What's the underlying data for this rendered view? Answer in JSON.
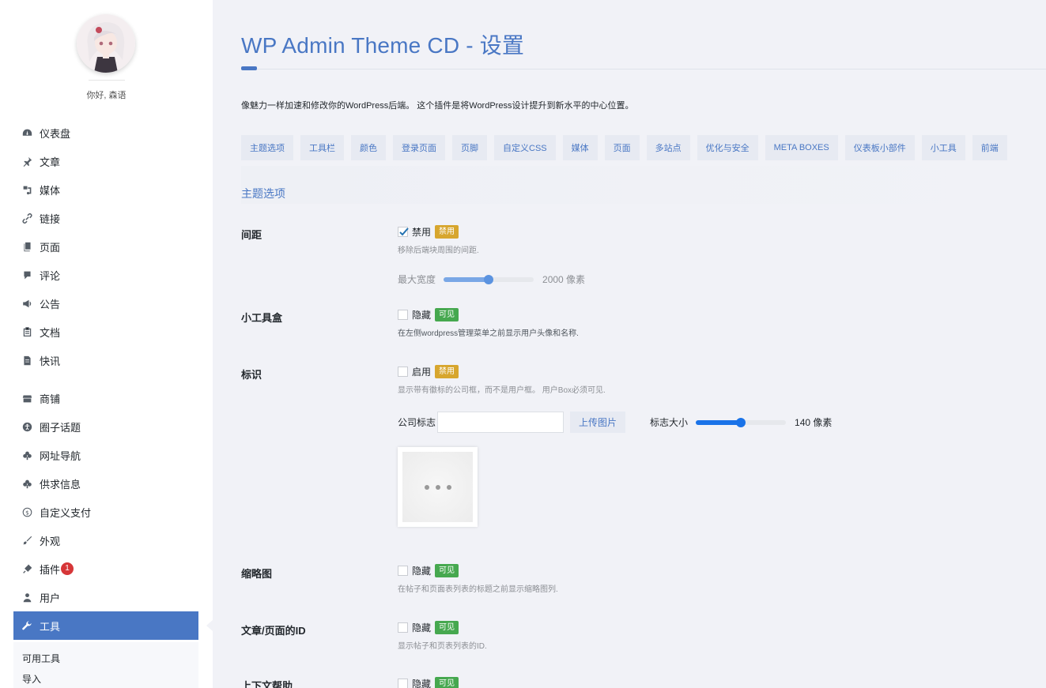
{
  "sidebar": {
    "greeting": "你好, 森语",
    "menu_items": [
      {
        "label": "仪表盘",
        "icon": "dashboard-icon"
      },
      {
        "label": "文章",
        "icon": "pin-icon"
      },
      {
        "label": "媒体",
        "icon": "media-icon"
      },
      {
        "label": "链接",
        "icon": "link-icon"
      },
      {
        "label": "页面",
        "icon": "page-icon"
      },
      {
        "label": "评论",
        "icon": "comment-icon"
      },
      {
        "label": "公告",
        "icon": "megaphone-icon"
      },
      {
        "label": "文档",
        "icon": "document-icon"
      },
      {
        "label": "快讯",
        "icon": "news-icon"
      },
      {
        "label": "商铺",
        "icon": "store-icon"
      },
      {
        "label": "圈子话题",
        "icon": "accessibility-icon"
      },
      {
        "label": "网址导航",
        "icon": "cloud-icon"
      },
      {
        "label": "供求信息",
        "icon": "cloud-icon"
      },
      {
        "label": "自定义支付",
        "icon": "dollar-icon"
      },
      {
        "label": "外观",
        "icon": "brush-icon"
      },
      {
        "label": "插件",
        "icon": "plugin-icon",
        "badge": "1"
      },
      {
        "label": "用户",
        "icon": "user-icon"
      },
      {
        "label": "工具",
        "icon": "wrench-icon",
        "active": true
      }
    ],
    "submenu": [
      "可用工具",
      "导入"
    ]
  },
  "header": {
    "title": "WP Admin Theme CD - 设置",
    "description": "像魅力一样加速和修改你的WordPress后端。 这个插件是将WordPress设计提升到新水平的中心位置。"
  },
  "tabs": [
    "主题选项",
    "工具栏",
    "颜色",
    "登录页面",
    "页脚",
    "自定义CSS",
    "媒体",
    "页面",
    "多站点",
    "优化与安全",
    "META BOXES",
    "仪表板小部件",
    "小工具",
    "前端"
  ],
  "section_title": "主题选项",
  "settings": {
    "spacing": {
      "label": "间距",
      "option": "禁用",
      "checked": true,
      "tag": "禁用",
      "hint": "移除后端块周围的间距.",
      "slider_label": "最大宽度",
      "slider_value": "2000 像素",
      "slider_fraction": 0.5
    },
    "widgetbox": {
      "label": "小工具盒",
      "option": "隐藏",
      "checked": false,
      "tag": "可见",
      "hint": "在左侧wordpress管理菜单之前显示用户头像和名称."
    },
    "logo": {
      "label": "标识",
      "option": "启用",
      "checked": false,
      "tag": "禁用",
      "hint": "显示带有徽标的公司框，而不是用户框。 用户Box必须可见.",
      "company_logo_label": "公司标志",
      "company_logo_value": "",
      "upload_label": "上传图片",
      "size_label": "标志大小",
      "size_value": "140 像素",
      "size_fraction": 0.5
    },
    "thumbnails": {
      "label": "缩略图",
      "option": "隐藏",
      "checked": false,
      "tag": "可见",
      "hint": "在帖子和页面表列表的标题之前显示缩略图列."
    },
    "post_ids": {
      "label": "文章/页面的ID",
      "option": "隐藏",
      "checked": false,
      "tag": "可见",
      "hint": "显示帖子和页表列表的ID."
    },
    "context_help": {
      "label": "上下文帮助",
      "option": "隐藏",
      "checked": false,
      "tag": "可见"
    }
  },
  "colors": {
    "accent": "#4977c4",
    "tag_yellow": "#d7a62e",
    "tag_green": "#46a84f",
    "badge": "#d63638",
    "slider_spacing": "#7aa7e6",
    "slider_logo": "#1a73e8"
  }
}
